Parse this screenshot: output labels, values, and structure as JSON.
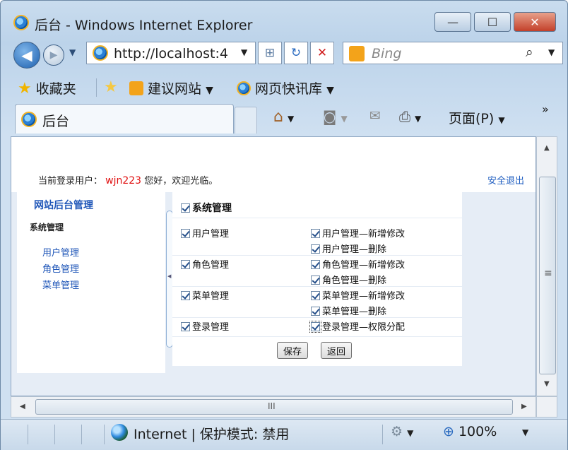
{
  "window": {
    "title": "后台 - Windows Internet Explorer",
    "minimize_label": "—",
    "maximize_label": "☐",
    "close_label": "✕"
  },
  "nav": {
    "back_icon": "back-arrow-icon",
    "forward_icon": "forward-arrow-icon",
    "address": "http://localhost:4",
    "search_placeholder": "Bing",
    "dropdown_glyph": "▼",
    "refresh_glyph": "↻",
    "stop_glyph": "✕",
    "compat_glyph": "⊞",
    "search_glyph": "⌕"
  },
  "favorites": {
    "label": "收藏夹",
    "suggested_sites": "建议网站",
    "web_slice": "网页快讯库",
    "arrow": "▼"
  },
  "tab": {
    "title": "后台"
  },
  "command_bar": {
    "home_glyph": "⌂",
    "feed_glyph": "◙",
    "mail_glyph": "✉",
    "print_glyph": "⎙",
    "page_menu": "页面(P)",
    "arrow": "▼",
    "more": "»"
  },
  "page": {
    "login_prefix": "当前登录用户：",
    "login_user": "wjn223",
    "login_suffix": "您好，欢迎光临。",
    "logout": "安全退出",
    "left": {
      "title": "网站后台管理",
      "section": "系统管理",
      "links": [
        "用户管理",
        "角色管理",
        "菜单管理"
      ]
    },
    "permissions": {
      "root": "系统管理",
      "groups": [
        {
          "name": "用户管理",
          "children": [
            "用户管理—新增修改",
            "用户管理—删除"
          ]
        },
        {
          "name": "角色管理",
          "children": [
            "角色管理—新增修改",
            "角色管理—删除"
          ]
        },
        {
          "name": "菜单管理",
          "children": [
            "菜单管理—新增修改",
            "菜单管理—删除"
          ]
        },
        {
          "name": "登录管理",
          "children": [
            "登录管理—权限分配"
          ]
        }
      ]
    },
    "buttons": {
      "save": "保存",
      "back": "返回"
    }
  },
  "scroll": {
    "up": "▲",
    "down": "▼",
    "left": "◀",
    "right": "▶",
    "grip": "≡",
    "hgrip": "III"
  },
  "status": {
    "zone": "Internet | 保护模式: 禁用",
    "zoom": "100%",
    "zoom_glyph": "⊕",
    "security_glyph": "⚙",
    "arrow": "▼"
  }
}
